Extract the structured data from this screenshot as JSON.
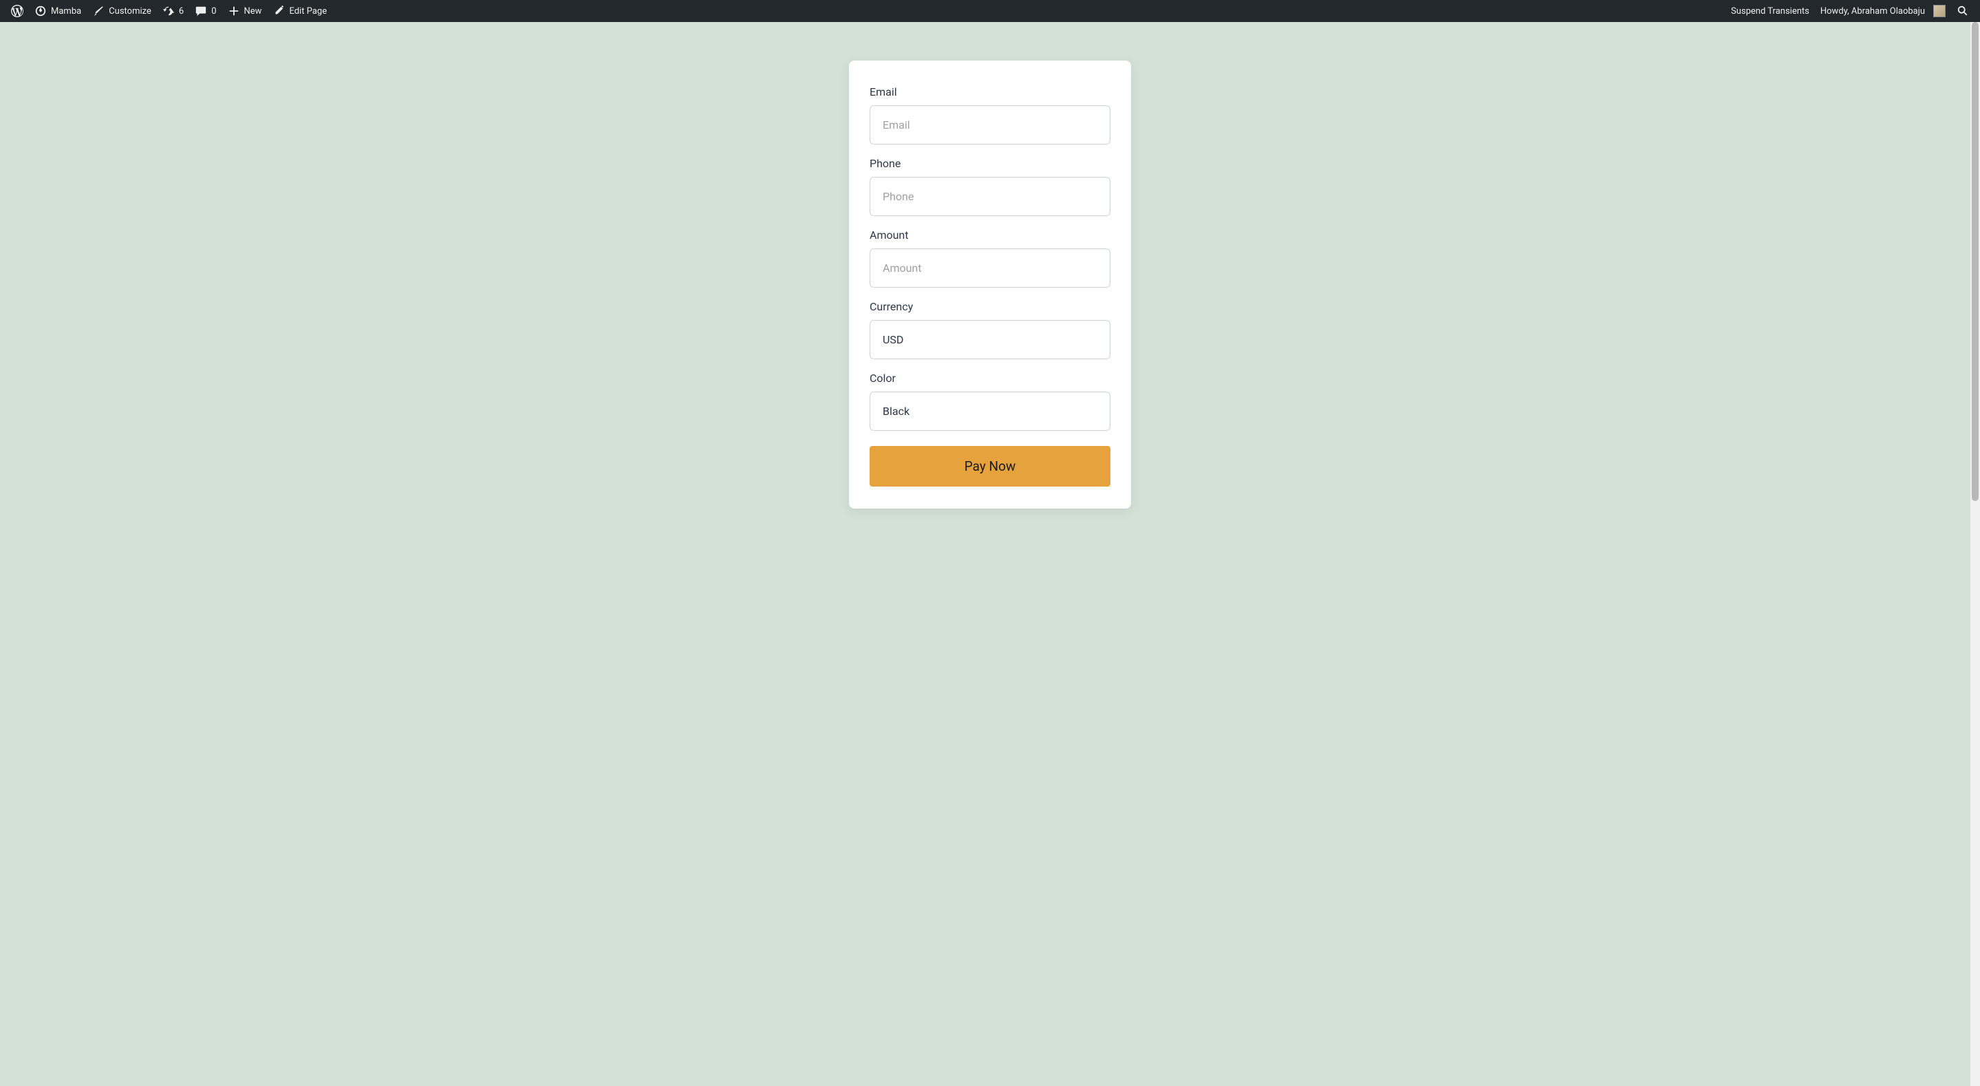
{
  "adminbar": {
    "site_name": "Mamba",
    "customize": "Customize",
    "updates_count": "6",
    "comments_count": "0",
    "new_label": "New",
    "edit_page": "Edit Page",
    "suspend_transients": "Suspend Transients",
    "howdy": "Howdy, Abraham Olaobaju"
  },
  "form": {
    "email": {
      "label": "Email",
      "placeholder": "Email"
    },
    "phone": {
      "label": "Phone",
      "placeholder": "Phone"
    },
    "amount": {
      "label": "Amount",
      "placeholder": "Amount"
    },
    "currency": {
      "label": "Currency",
      "value": "USD"
    },
    "color": {
      "label": "Color",
      "value": "Black"
    },
    "submit": "Pay Now"
  }
}
